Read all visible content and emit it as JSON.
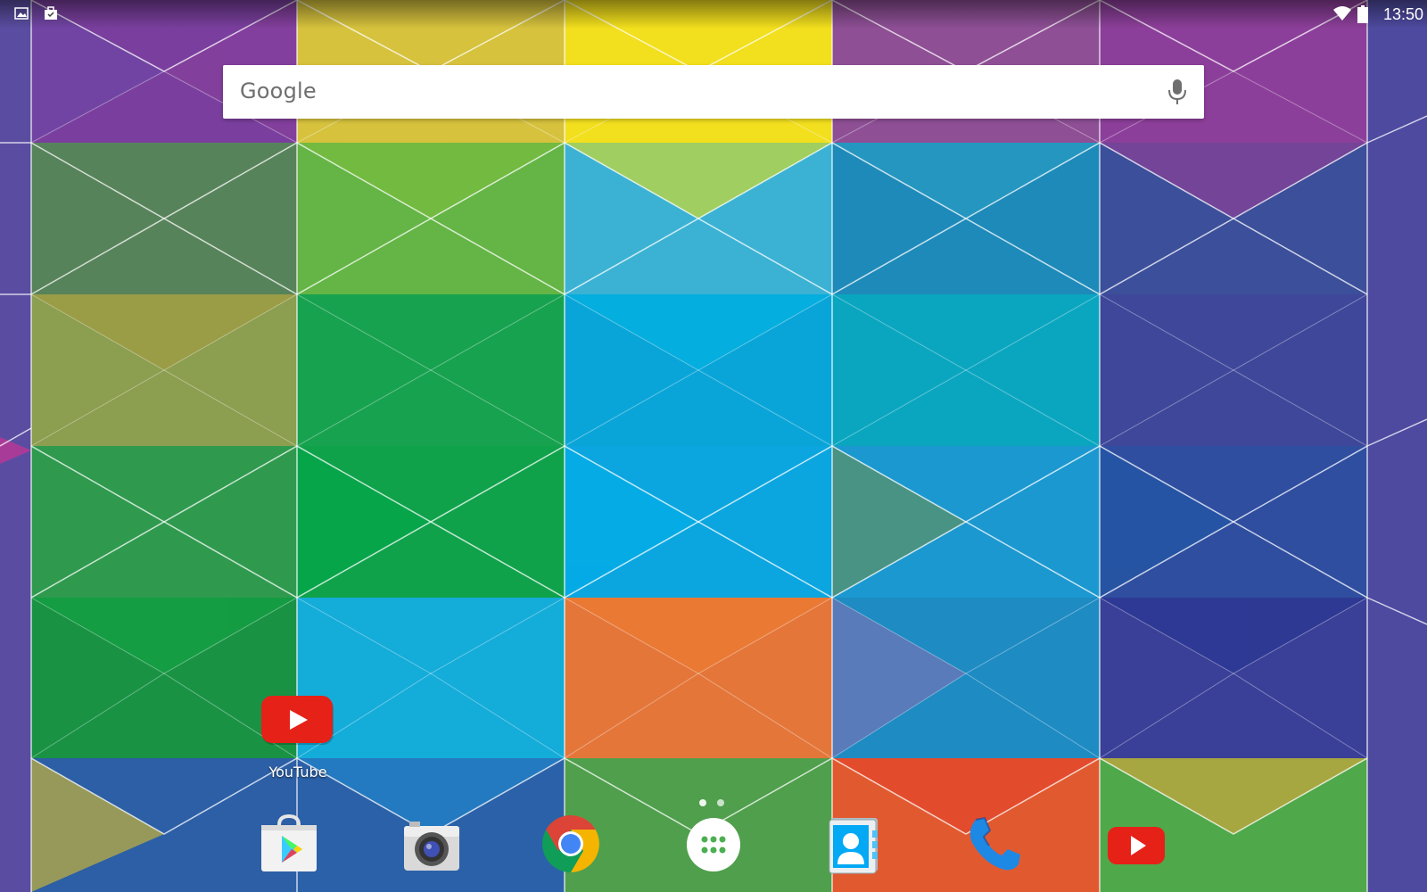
{
  "status_bar": {
    "time": "13:50",
    "icons": [
      "gallery-notification-icon",
      "briefcase-notification-icon",
      "wifi-icon",
      "battery-icon"
    ]
  },
  "search": {
    "logo_text": "Google",
    "mic_icon": "microphone-icon"
  },
  "home_apps": [
    {
      "label": "YouTube",
      "icon": "youtube-icon"
    }
  ],
  "dock": [
    {
      "icon": "play-store-icon"
    },
    {
      "icon": "camera-icon"
    },
    {
      "icon": "chrome-icon"
    },
    {
      "icon": "app-drawer-icon"
    },
    {
      "icon": "contacts-icon"
    },
    {
      "icon": "phone-icon"
    },
    {
      "icon": "youtube-icon"
    }
  ],
  "colors": {
    "youtube_red": "#e62117",
    "chrome_red": "#db4437",
    "chrome_yellow": "#f4b400",
    "chrome_green": "#0f9d58",
    "chrome_blue": "#4285f4",
    "phone_blue": "#1e88e5"
  }
}
